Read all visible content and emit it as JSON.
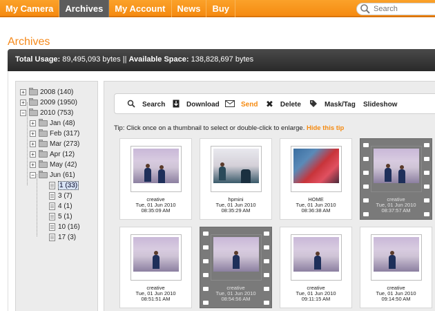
{
  "nav": {
    "items": [
      "My Camera",
      "Archives",
      "My Account",
      "News",
      "Buy"
    ],
    "active": "Archives",
    "search_placeholder": "Search"
  },
  "page_title": "Archives",
  "usage": {
    "total_label": "Total Usage:",
    "total_value": "89,495,093 bytes ||",
    "available_label": "Available Space:",
    "available_value": "138,828,697 bytes"
  },
  "tree": {
    "years": [
      {
        "label": "2008 (140)",
        "expanded": false
      },
      {
        "label": "2009 (1950)",
        "expanded": false
      },
      {
        "label": "2010 (753)",
        "expanded": true
      }
    ],
    "months": [
      {
        "label": "Jan (48)"
      },
      {
        "label": "Feb (317)"
      },
      {
        "label": "Mar (273)"
      },
      {
        "label": "Apr (12)"
      },
      {
        "label": "May (42)"
      },
      {
        "label": "Jun (61)"
      }
    ],
    "days": [
      "1 (33)",
      "3 (7)",
      "4 (1)",
      "5 (1)",
      "10 (16)",
      "17 (3)"
    ],
    "selected_day": "1 (33)"
  },
  "toolbar": {
    "search": "Search",
    "download": "Download",
    "send": "Send",
    "delete": "Delete",
    "mask": "Mask/Tag",
    "slideshow": "Slideshow"
  },
  "tip": {
    "text": "Tip: Click once on a thumbnail to select or double-click to enlarge.",
    "link": "Hide this tip"
  },
  "thumbnails": [
    {
      "name": "creative",
      "date": "Tue, 01 Jun 2010",
      "time": "08:35:09 AM",
      "video": false
    },
    {
      "name": "hpmini",
      "date": "Tue, 01 Jun 2010",
      "time": "08:35:29 AM",
      "video": false
    },
    {
      "name": "HOME",
      "date": "Tue, 01 Jun 2010",
      "time": "08:36:38 AM",
      "video": false
    },
    {
      "name": "creative",
      "date": "Tue, 01 Jun 2010",
      "time": "08:37:57 AM",
      "video": true
    },
    {
      "name": "creative",
      "date": "Tue, 01 Jun 2010",
      "time": "08:51:51 AM",
      "video": false
    },
    {
      "name": "creative",
      "date": "Tue, 01 Jun 2010",
      "time": "08:54:56 AM",
      "video": true
    },
    {
      "name": "creative",
      "date": "Tue, 01 Jun 2010",
      "time": "09:11:15 AM",
      "video": false
    },
    {
      "name": "creative",
      "date": "Tue, 01 Jun 2010",
      "time": "09:14:50 AM",
      "video": false
    }
  ],
  "colors": {
    "accent": "#f58a10",
    "nav_active": "#5c5c5c",
    "usage_bar": "#333333"
  }
}
